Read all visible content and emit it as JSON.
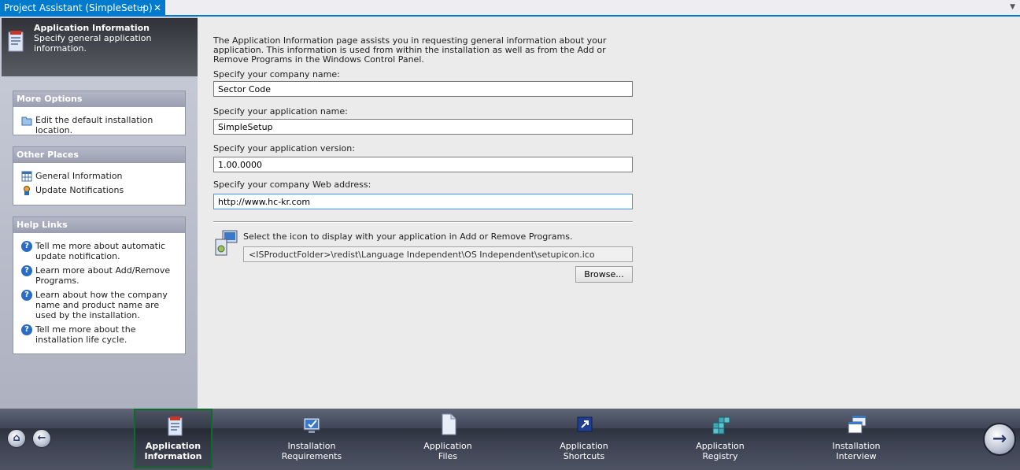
{
  "tab": {
    "title": "Project Assistant (SimpleSetup)",
    "pin_glyph": "⊣",
    "close_glyph": "✕"
  },
  "sidebar": {
    "header_title": "Application Information",
    "header_subtitle": "Specify general application information.",
    "more_options": {
      "title": "More Options",
      "items": [
        {
          "label": "Edit the default installation location.",
          "icon": "folder-icon"
        }
      ]
    },
    "other_places": {
      "title": "Other Places",
      "items": [
        {
          "label": "General Information",
          "icon": "table-icon"
        },
        {
          "label": "Update Notifications",
          "icon": "update-icon"
        }
      ]
    },
    "help_links": {
      "title": "Help Links",
      "items": [
        {
          "label": "Tell me more about automatic update notification.",
          "icon": "help-icon"
        },
        {
          "label": "Learn more about Add/Remove Programs.",
          "icon": "help-icon"
        },
        {
          "label": "Learn about how the company name and product name are used by the installation.",
          "icon": "help-icon"
        },
        {
          "label": "Tell me more about the installation life cycle.",
          "icon": "help-icon"
        }
      ]
    }
  },
  "main": {
    "intro": "The Application Information page assists you in requesting general information about your application. This information is used from within the installation as well as from the Add or Remove Programs in the Windows Control Panel.",
    "company_label": "Specify your company name:",
    "company_value": "Sector Code",
    "appname_label": "Specify your application name:",
    "appname_value": "SimpleSetup",
    "version_label": "Specify your application version:",
    "version_value": "1.00.0000",
    "web_label": "Specify your company Web address:",
    "web_value": "http://www.hc-kr.com",
    "icon_label": "Select the icon to display with your application in Add or Remove Programs.",
    "icon_path": "<ISProductFolder>\\redist\\Language Independent\\OS Independent\\setupicon.ico",
    "browse_label": "Browse..."
  },
  "bottom": {
    "home_glyph": "⌂",
    "back_glyph": "←",
    "next_glyph": "→",
    "steps": [
      {
        "line1": "Application",
        "line2": "Information",
        "active": true
      },
      {
        "line1": "Installation",
        "line2": "Requirements",
        "active": false
      },
      {
        "line1": "Application",
        "line2": "Files",
        "active": false
      },
      {
        "line1": "Application",
        "line2": "Shortcuts",
        "active": false
      },
      {
        "line1": "Application",
        "line2": "Registry",
        "active": false
      },
      {
        "line1": "Installation",
        "line2": "Interview",
        "active": false
      }
    ]
  },
  "colors": {
    "accent": "#007acc",
    "active_step_border": "#0f6b2a",
    "help_icon": "#2a6bc4"
  }
}
